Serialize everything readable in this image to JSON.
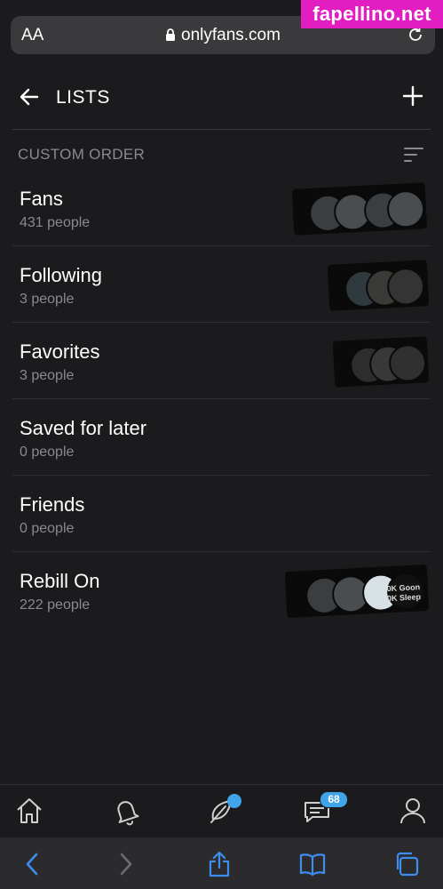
{
  "browser": {
    "text_size_label": "AA",
    "url": "onlyfans.com"
  },
  "watermark": "fapellino.net",
  "header": {
    "title": "LISTS"
  },
  "section": {
    "label": "CUSTOM ORDER"
  },
  "lists": [
    {
      "name": "Fans",
      "count": "431 people"
    },
    {
      "name": "Following",
      "count": "3 people"
    },
    {
      "name": "Favorites",
      "count": "3 people"
    },
    {
      "name": "Saved for later",
      "count": "0 people"
    },
    {
      "name": "Friends",
      "count": "0 people"
    },
    {
      "name": "Rebill On",
      "count": "222 people"
    }
  ],
  "rebill_thumb_caption": "10K Goon 10K Sleep",
  "tabbar": {
    "icons": [
      "home-icon",
      "bell-icon",
      "feather-icon",
      "messages-icon",
      "profile-icon"
    ],
    "messages_badge": "68",
    "accent": "#3fa5e8"
  },
  "safari_toolbar": {
    "icons": [
      "back-icon",
      "forward-icon",
      "share-icon",
      "bookmarks-icon",
      "tabs-icon"
    ]
  }
}
